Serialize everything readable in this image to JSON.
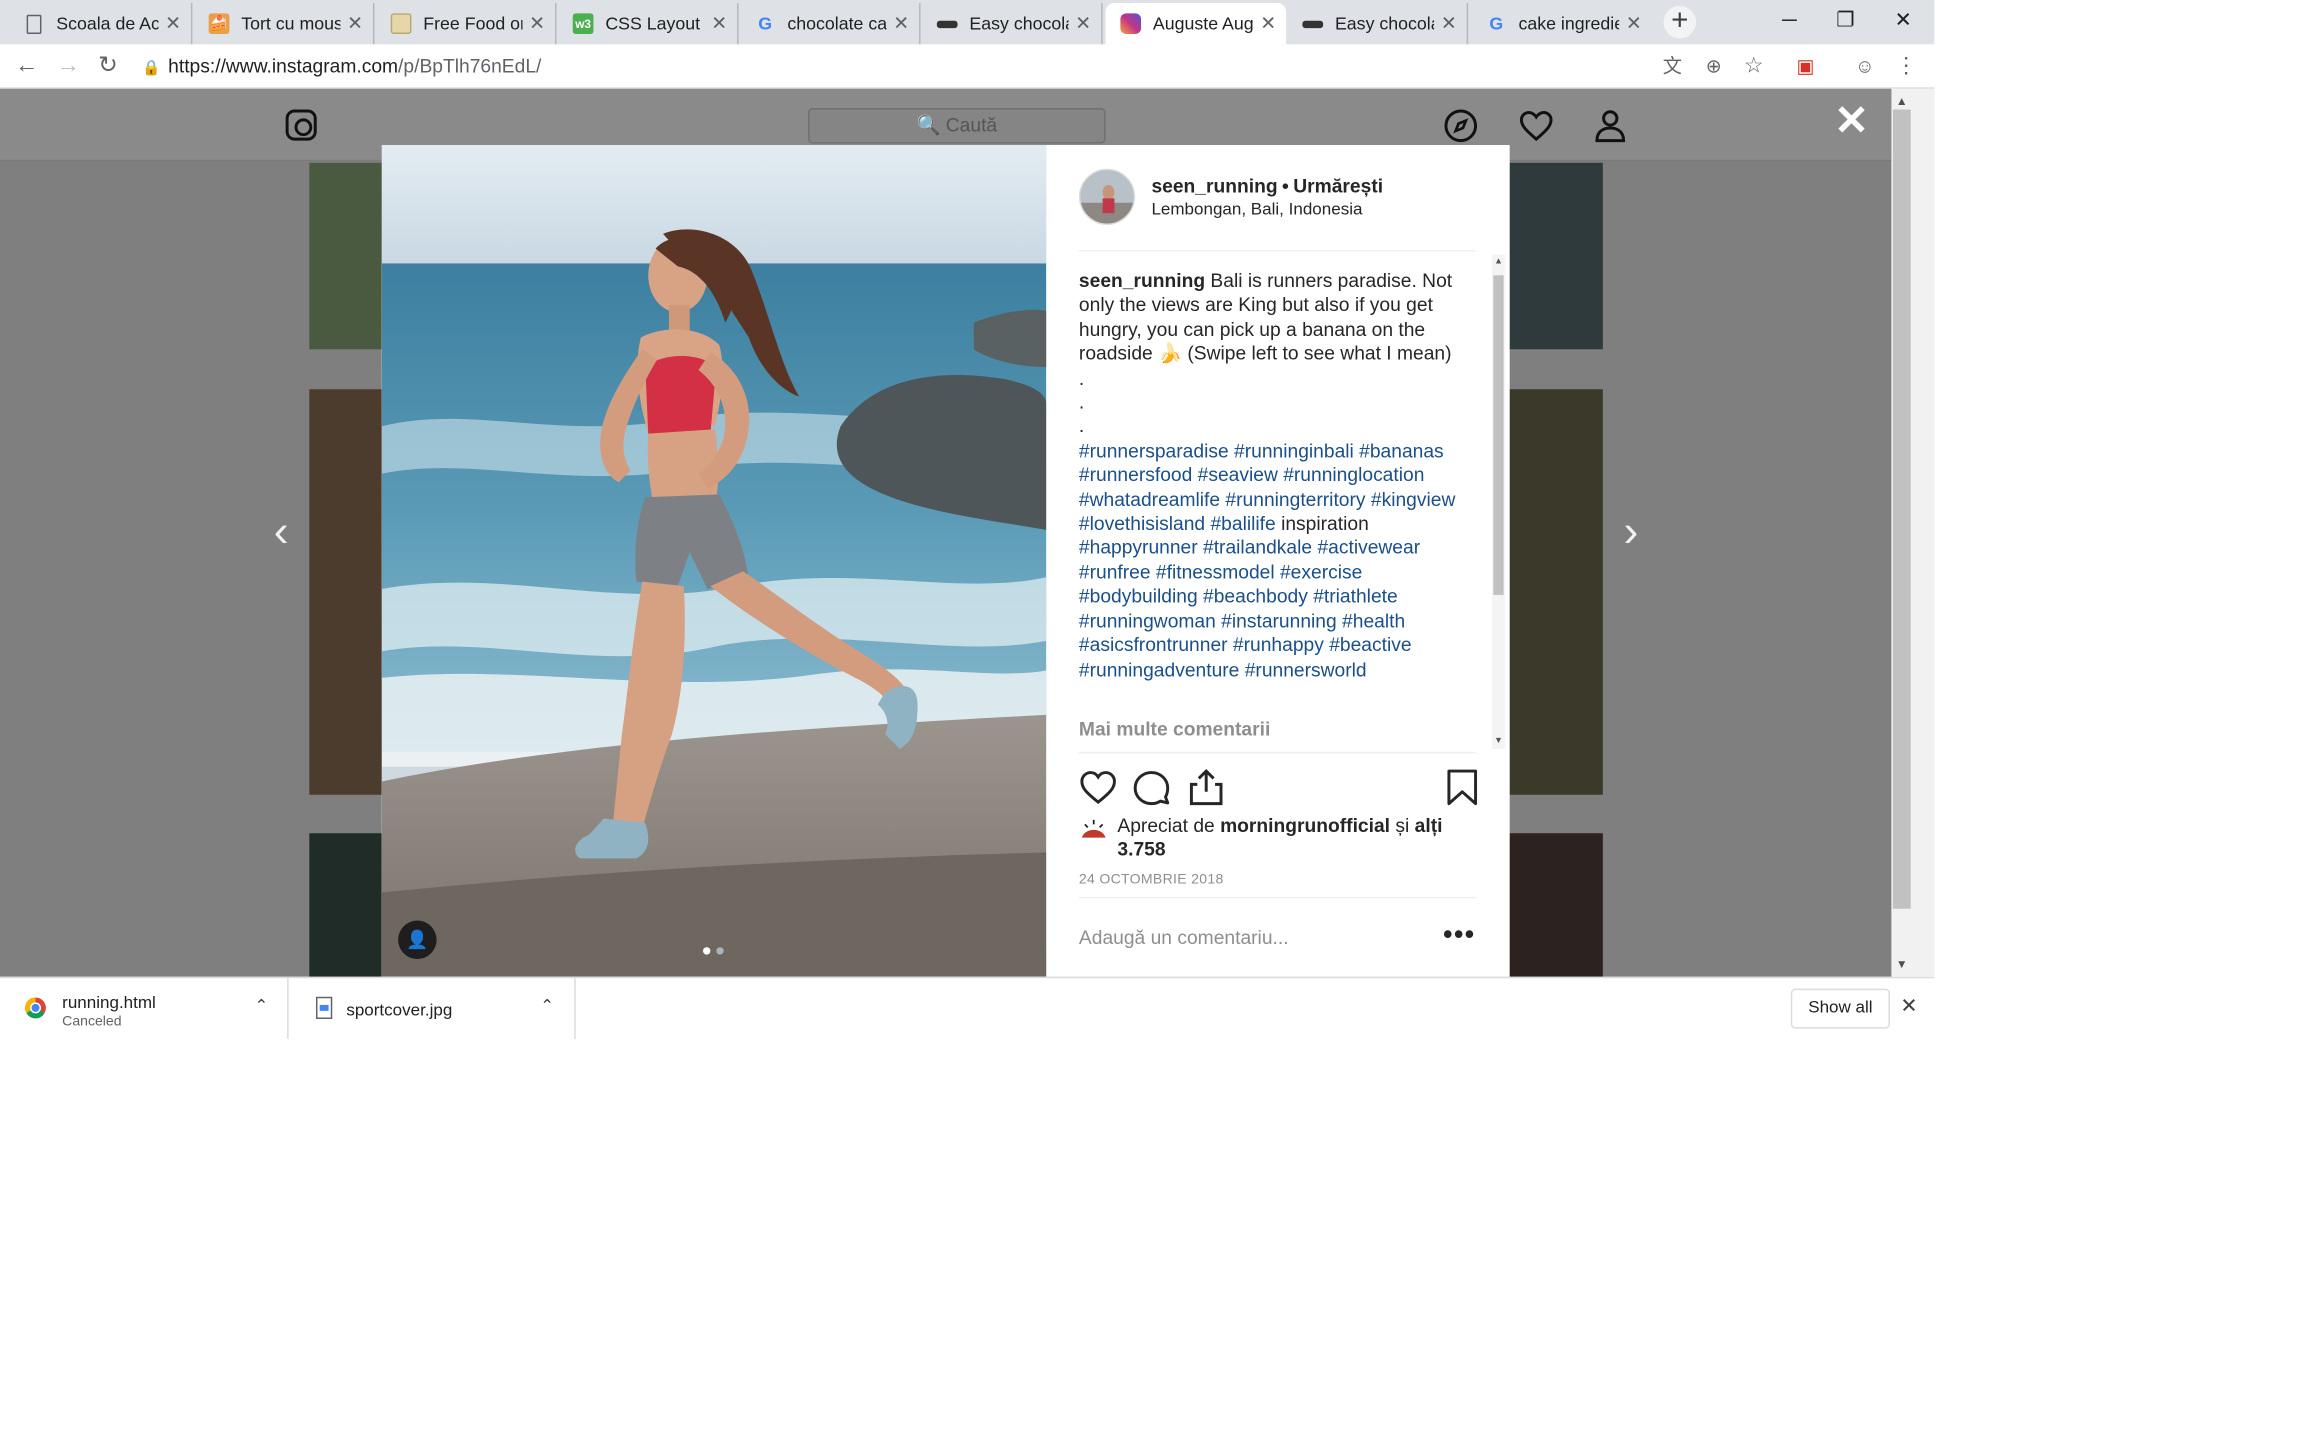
{
  "browser": {
    "tabs": [
      {
        "label": "Scoala de Acas",
        "favicon": "page-icon"
      },
      {
        "label": "Tort cu mousse",
        "favicon": "recipe-site-icon"
      },
      {
        "label": "Free Food or D",
        "favicon": "image-icon"
      },
      {
        "label": "CSS Layout - H",
        "favicon": "w3schools-icon"
      },
      {
        "label": "chocolate cake",
        "favicon": "google-icon"
      },
      {
        "label": "Easy chocolate",
        "favicon": "site-icon"
      },
      {
        "label": "Auguste Augus",
        "favicon": "instagram-icon"
      },
      {
        "label": "Easy chocolate",
        "favicon": "site-icon"
      },
      {
        "label": "cake ingredien",
        "favicon": "google-icon"
      }
    ],
    "active_tab_index": 6,
    "new_tab": "+",
    "window_controls": {
      "minimize": "─",
      "restore": "❐",
      "close": "✕"
    },
    "url_main": "https://www.instagram.com",
    "url_rest": "/p/BpTlh76nEdL/"
  },
  "instagram": {
    "search_placeholder": "🔍 Caută",
    "close": "✕",
    "prev": "‹",
    "next": "›"
  },
  "post": {
    "username": "seen_running",
    "separator": "•",
    "follow_label": "Urmărești",
    "location": "Lembongan, Bali, Indonesia",
    "caption_user": "seen_running",
    "caption_text": " Bali is runners paradise. Not only the views are King but also if you get hungry, you can pick up a banana on the roadside 🍌 (Swipe left to see what I mean)",
    "dot_lines": [
      ".",
      ".",
      "."
    ],
    "hashtags_a": "#runnersparadise #runninginbali #bananas #runnersfood #seaview #runninglocation #whatadreamlife #runningterritory #kingview #lovethisisland #balilife",
    "plain_word": " inspiration ",
    "hashtags_b": "#happyrunner #trailandkale #activewear #runfree #fitnessmodel #exercise #bodybuilding #beachbody #triathlete #runningwoman #instarunning #health #asicsfrontrunner #runhappy #beactive #runningadventure #runnersworld",
    "more_comments": "Mai multe comentarii",
    "likes_prefix": "Apreciat de ",
    "likes_user": "morningrunofficial",
    "likes_mid": " și ",
    "likes_count": "alți 3.758",
    "date": "24 OCTOMBRIE 2018",
    "add_comment_placeholder": "Adaugă un comentariu...",
    "more_options": "•••",
    "carousel_index": 1,
    "carousel_total": 2
  },
  "downloads": {
    "items": [
      {
        "name": "running.html",
        "status": "Canceled"
      },
      {
        "name": "sportcover.jpg",
        "status": ""
      }
    ],
    "show_all": "Show all",
    "close": "✕"
  },
  "colors": {
    "hashtag": "#1a4f8a",
    "overlay": "#7f7f7f",
    "instagram_pink": "#c13584"
  }
}
